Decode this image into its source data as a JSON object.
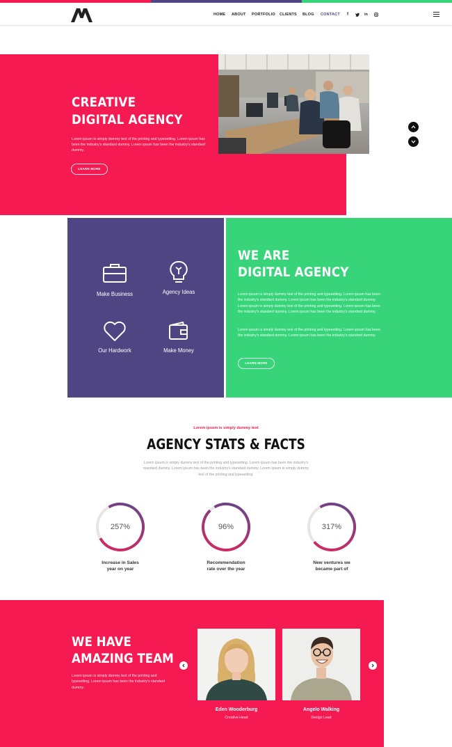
{
  "colors": {
    "accent_pink": "#f51a52",
    "accent_purple": "#504583",
    "accent_green": "#38d47a",
    "ring_gradient_start": "#e0265d",
    "ring_gradient_end": "#5a4a8e"
  },
  "nav": {
    "logo_icon": "m-logo-icon",
    "items": [
      {
        "label": "HOME"
      },
      {
        "label": "ABOUT"
      },
      {
        "label": "PORTFOLIO"
      },
      {
        "label": "CLIENTS"
      },
      {
        "label": "BLOG"
      },
      {
        "label": "CONTACT",
        "active": true
      }
    ],
    "social": [
      {
        "icon": "facebook-icon",
        "glyph": "f"
      },
      {
        "icon": "twitter-icon",
        "glyph": "t"
      },
      {
        "icon": "linkedin-icon",
        "glyph": "in"
      },
      {
        "icon": "instagram-icon",
        "glyph": "◎"
      }
    ],
    "menu_icon": "hamburger-menu-icon"
  },
  "hero": {
    "title_line1": "CREATIVE",
    "title_line2": "DIGITAL AGENCY",
    "text": "Lorem ipsum is simply dummy text of the printing and typesetting. Lorem ipsum has been the industry's standard dummy. Lorem ipsum has been the industry's standard dummy.",
    "button": "LEARN MORE",
    "slider_up_icon": "chevron-up-icon",
    "slider_down_icon": "chevron-down-icon"
  },
  "features": [
    {
      "label": "Make Business",
      "icon": "briefcase-icon"
    },
    {
      "label": "Agency Ideas",
      "icon": "lightbulb-icon"
    },
    {
      "label": "Our Hardwork",
      "icon": "heart-icon"
    },
    {
      "label": "Make Money",
      "icon": "wallet-icon"
    }
  ],
  "about": {
    "title_line1": "WE ARE",
    "title_line2": "DIGITAL AGENCY",
    "paragraph1": "Lorem ipsum is simply dummy text of the printing and typesetting. Lorem ipsum has been the industry's standard dummy. Lorem ipsum has been the industry's standard dummy. Lorem ipsum is simply dummy text of the printing and typesetting. Lorem ipsum has been the industry's standard dummy. Lorem ipsum has been the industry's standard dummy.",
    "paragraph2": "Lorem ipsum is simply dummy text of the printing and typesetting. Lorem ipsum has been the industry's standard dummy. Lorem ipsum has been the industry's standard dummy.",
    "button": "LEARN MORE"
  },
  "stats": {
    "eyebrow": "Lorem ipsum is simply dummy text",
    "title": "AGENCY STATS & FACTS",
    "text": "Lorem ipsum is simply dummy text of the printing and typesetting. Lorem ipsum has been the industry's standard dummy. Lorem ipsum has been the industry's standard dummy. Lorem ipsum is simply dummy text of the printing and typesetting.",
    "items": [
      {
        "value": "257%",
        "fill": 0.75,
        "label_line1": "Increase in Sales",
        "label_line2": "year on year"
      },
      {
        "value": "96%",
        "fill": 0.96,
        "label_line1": "Recommendation",
        "label_line2": "rate over the year"
      },
      {
        "value": "317%",
        "fill": 0.72,
        "label_line1": "New ventures we",
        "label_line2": "became part of"
      }
    ]
  },
  "team": {
    "title_line1": "WE HAVE",
    "title_line2": "AMAZING TEAM",
    "text": "Lorem ipsum is simply dummy text of the printing and typesetting. Lorem ipsum has been the industry's standard dummy.",
    "prev_icon": "chevron-left-icon",
    "next_icon": "chevron-right-icon",
    "members": [
      {
        "name": "Eden Wooderburg",
        "role": "Creative Head"
      },
      {
        "name": "Angelo Walking",
        "role": "Design Lead"
      }
    ]
  }
}
